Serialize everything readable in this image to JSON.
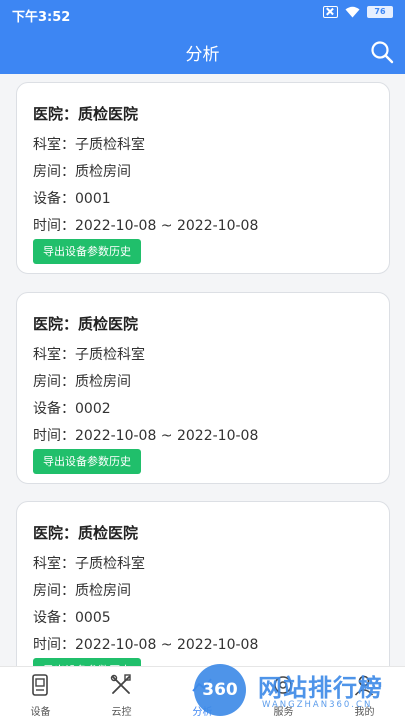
{
  "status_bar": {
    "time": "下午3:52",
    "battery": "76"
  },
  "header": {
    "title": "分析",
    "search_icon": "search-icon"
  },
  "records": [
    {
      "hospital": "医院：质检医院",
      "department": "科室：子质检科室",
      "room": "房间：质检房间",
      "device": "设备：0001",
      "time": "时间：2022-10-08 ~ 2022-10-08",
      "export_label": "导出设备参数历史"
    },
    {
      "hospital": "医院：质检医院",
      "department": "科室：子质检科室",
      "room": "房间：质检房间",
      "device": "设备：0002",
      "time": "时间：2022-10-08 ~ 2022-10-08",
      "export_label": "导出设备参数历史"
    },
    {
      "hospital": "医院：质检医院",
      "department": "科室：子质检科室",
      "room": "房间：质检房间",
      "device": "设备：0005",
      "time": "时间：2022-10-08 ~ 2022-10-08",
      "export_label": "导出设备参数历史"
    }
  ],
  "tabbar": {
    "items": [
      {
        "label": "设备",
        "icon": "device-icon"
      },
      {
        "label": "云控",
        "icon": "tools-icon"
      },
      {
        "label": "分析",
        "icon": "analysis-icon"
      },
      {
        "label": "服务",
        "icon": "service-icon"
      },
      {
        "label": "我的",
        "icon": "user-icon"
      }
    ]
  },
  "watermark": {
    "logo_text": "360",
    "title": "网站排行榜",
    "subtitle": "WANGZHAN360.CN"
  },
  "colors": {
    "primary": "#3d86f3",
    "export_button": "#20bf6b",
    "watermark": "#3f8be8"
  }
}
